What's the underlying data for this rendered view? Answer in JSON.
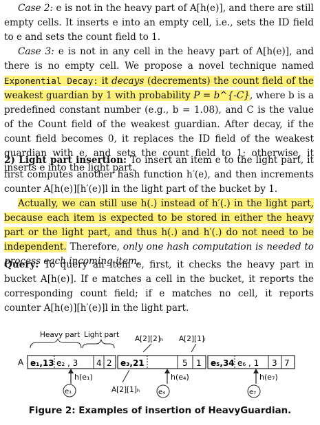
{
  "text": {
    "case2_label": "Case 2:",
    "case2_body": "e is not in the heavy part of A[h(e)], and there are still empty cells. It inserts e into an empty cell, i.e., sets the ID field to e and sets the count field to 1.",
    "case3_label": "Case 3:",
    "case3_a": "e is not in any cell in the heavy part of A[h(e)], and there is no empty cell. We propose a novel technique named",
    "case3_mono": "Exponential Decay:",
    "case3_b": "it",
    "case3_decays": "decays",
    "case3_c": "(decrements) the count field of the weakest guardian by 1 with probability",
    "case3_prob": "P = b^{-C}",
    "case3_d": ", where b is a predefined constant number (e.g., b = 1.08), and C is the value of the Count field of the weakest guardian. After decay, if the count field becomes 0, it replaces the ID field of the weakest guardian with e, and sets the count field to 1; otherwise, it inserts e into the light part.",
    "light_label": "2) Light part insertion:",
    "light_body": "To insert an item e to the light part, it first computes another hash function h′(e), and then increments counter A[h(e)][h′(e)]l in the light part of the bucket by 1.",
    "actually_hl": "Actually, we can still use h(.) instead of h′(.) in the light part, because each item is expected to be stored in either the heavy part or the light part, and thus h(.) and h′(.) do not need to be independent.",
    "therefore": "Therefore,",
    "therefore_it": "only one hash computation is needed to process each incoming item.",
    "query_label": "Query:",
    "query_body": "To query an item e, first, it checks the heavy part in bucket A[h(e)]. If e matches a cell in the bucket, it reports the corresponding count field; if e matches no cell, it reports counter A[h(e)][h′(e)]l in the light part."
  },
  "figure": {
    "heavy_label": "Heavy part",
    "light_label": "Light part",
    "array_label": "A",
    "top_label_1": "A[2][2]ₕ",
    "top_label_2": "A[2][1]ₗ",
    "bottom_label": "A[2][1]ₕ",
    "bucket1_cells": [
      "e₁,13",
      "e₂ , 3",
      "4",
      "2"
    ],
    "bucket2_cells": [
      "e₃,21",
      "",
      "5",
      "1"
    ],
    "bucket3_cells": [
      "e₅,34",
      "e₆ , 1",
      "3",
      "7"
    ],
    "hash_labels": [
      "h(e₁)",
      "h(e₄)",
      "h(e₇)"
    ],
    "items": [
      "e₁",
      "e₄",
      "e₇"
    ]
  },
  "caption": "Figure 2: Examples of insertion of HeavyGuardian."
}
